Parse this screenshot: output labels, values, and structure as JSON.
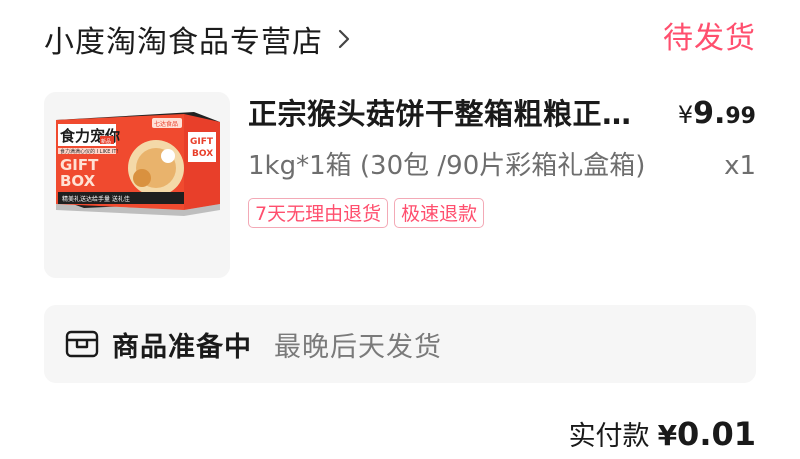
{
  "store": {
    "name": "小度淘淘食品专营店",
    "status": "待发货"
  },
  "product": {
    "title": "正宗猴头菇饼干整箱粗粮正…",
    "price_symbol": "¥",
    "price_int": "9.",
    "price_dec": "99",
    "spec": "1kg*1箱 (30包 /90片彩箱礼盒箱)",
    "qty": "x1",
    "tags": [
      "7天无理由退货",
      "极速退款"
    ],
    "thumb_text": {
      "headline": "食力宠你",
      "subline": "食力满满心仪的 I LIKE IT!",
      "gift": "GIFT",
      "box": "BOX",
      "side_gift": "GIFT",
      "side_box": "BOX",
      "footer": "精美礼送达给手量 送礼佳",
      "badge": "新品",
      "logo": "七达食品"
    }
  },
  "shipping": {
    "title": "商品准备中",
    "subtitle": "最晚后天发货"
  },
  "total": {
    "label": "实付款",
    "symbol": "¥",
    "value": "0.01"
  },
  "colors": {
    "accent": "#ff4f6e",
    "text": "#1a1a1a",
    "muted": "#7a7a7a",
    "box_bg": "#f6f6f6"
  }
}
